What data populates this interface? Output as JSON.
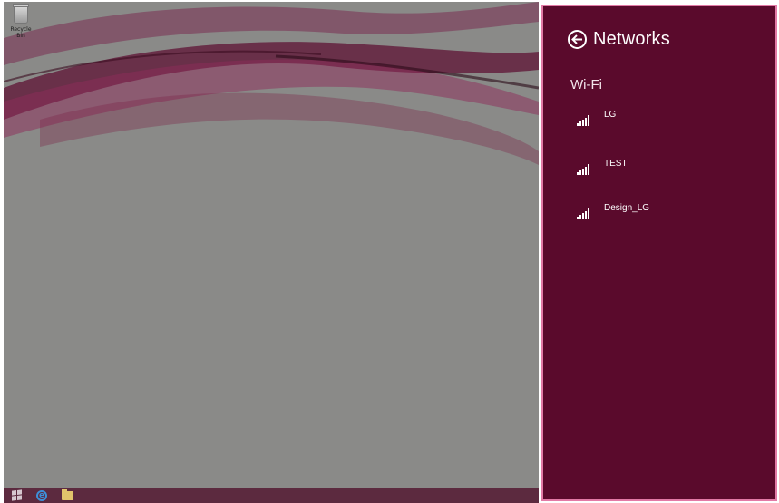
{
  "desktop": {
    "recycle_bin_label": "Recycle Bin"
  },
  "taskbar": {
    "items": [
      {
        "icon": "windows-logo-icon"
      },
      {
        "icon": "internet-explorer-icon"
      },
      {
        "icon": "file-explorer-icon"
      }
    ]
  },
  "panel": {
    "title": "Networks",
    "back_icon": "back-arrow-circle-icon",
    "section_label": "Wi-Fi",
    "networks": [
      {
        "name": "LG",
        "icon": "wifi-signal-icon"
      },
      {
        "name": "TEST",
        "icon": "wifi-signal-icon"
      },
      {
        "name": "Design_LG",
        "icon": "wifi-signal-icon"
      }
    ]
  },
  "colors": {
    "panel_bg": "#5a0a2c",
    "panel_border": "#e27aa6",
    "desktop_bg": "#8a8a88",
    "taskbar_bg": "#5c2a3f"
  }
}
